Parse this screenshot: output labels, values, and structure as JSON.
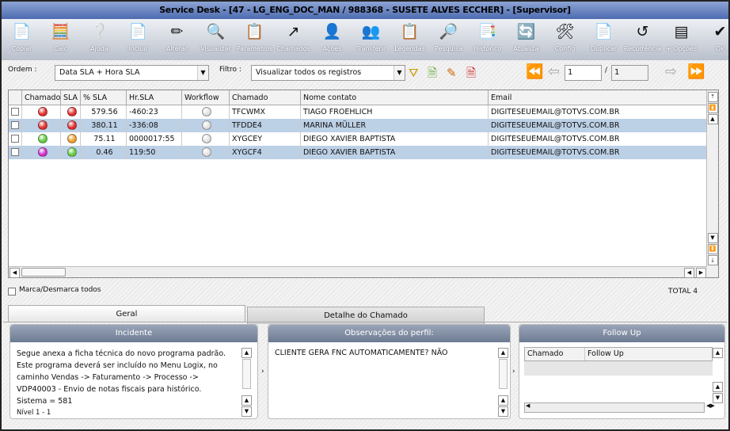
{
  "window": {
    "title": "Service Desk - [47 - LG_ENG_DOC_MAN / 988368 - SUSETE ALVES ECCHER] - [Supervisor]"
  },
  "toolbar": [
    {
      "label": "Copiar",
      "icon": "copy-icon",
      "glyph": "📄"
    },
    {
      "label": "Calc",
      "icon": "calculator-icon",
      "glyph": "🧮"
    },
    {
      "label": "Ajuda",
      "icon": "help-icon",
      "glyph": "❔"
    },
    {
      "label": "Incluir",
      "icon": "add-document-icon",
      "glyph": "📄"
    },
    {
      "label": "Alterar",
      "icon": "edit-icon",
      "glyph": "✏"
    },
    {
      "label": "Visualizar",
      "icon": "view-icon",
      "glyph": "🔍"
    },
    {
      "label": "Parametros",
      "icon": "parameters-icon",
      "glyph": "📋"
    },
    {
      "label": "Chamados",
      "icon": "tickets-icon",
      "glyph": "↗"
    },
    {
      "label": "Ações",
      "icon": "actions-icon",
      "glyph": "👤"
    },
    {
      "label": "Transferir",
      "icon": "transfer-icon",
      "glyph": "👥"
    },
    {
      "label": "Legendas",
      "icon": "legend-icon",
      "glyph": "📋"
    },
    {
      "label": "Pesquisa",
      "icon": "search-icon",
      "glyph": "🔎"
    },
    {
      "label": "Histórico",
      "icon": "history-icon",
      "glyph": "📑"
    },
    {
      "label": "Atualiza",
      "icon": "refresh-icon",
      "glyph": "🔄"
    },
    {
      "label": "Config",
      "icon": "tools-icon",
      "glyph": "🛠"
    },
    {
      "label": "Duplicar",
      "icon": "duplicate-icon",
      "glyph": "📄"
    },
    {
      "label": "Recorrência",
      "icon": "recurrence-icon",
      "glyph": "↺"
    },
    {
      "label": "+ Opções",
      "icon": "more-options-icon",
      "glyph": "▤"
    },
    {
      "label": "Ok",
      "icon": "check-icon",
      "glyph": "✔"
    }
  ],
  "filters": {
    "ordem_label": "Ordem :",
    "ordem_value": "Data SLA + Hora SLA",
    "filtro_label": "Filtro :",
    "filtro_value": "Visualizar todos os registros"
  },
  "pagination": {
    "current": "1",
    "separator": "/",
    "total": "1"
  },
  "grid": {
    "columns": [
      "",
      "Chamado",
      "SLA",
      "% SLA",
      "Hr.SLA",
      "Workflow",
      "Chamado",
      "Nome contato",
      "Email"
    ],
    "rows": [
      {
        "status": "#e03030",
        "sla": "#e03030",
        "pct": "579.56",
        "hr": "-460:23",
        "ticket": "TFCWMX",
        "contact": "TIAGO FROEHLICH",
        "email": "DIGITESEUEMAIL@TOTVS.COM.BR"
      },
      {
        "status": "#e03030",
        "sla": "#e03030",
        "pct": "380.11",
        "hr": "-336:08",
        "ticket": "TFDDE4",
        "contact": "MARINA MÜLLER",
        "email": "DIGITESEUEMAIL@TOTVS.COM.BR"
      },
      {
        "status": "#66cc44",
        "sla": "#f0a030",
        "pct": "75.11",
        "hr": "0000017:55",
        "ticket": "XYGCEY",
        "contact": "DIEGO XAVIER BAPTISTA",
        "email": "DIGITESEUEMAIL@TOTVS.COM.BR"
      },
      {
        "status": "#d030d0",
        "sla": "#66cc44",
        "pct": "0.46",
        "hr": "119:50",
        "ticket": "XYGCF4",
        "contact": "DIEGO XAVIER BAPTISTA",
        "email": "DIGITESEUEMAIL@TOTVS.COM.BR"
      }
    ]
  },
  "footer": {
    "select_all": "Marca/Desmarca todos",
    "total": "TOTAL 4"
  },
  "tabs": [
    "Geral",
    "Detalhe do Chamado"
  ],
  "panels": {
    "incidente": {
      "title": "Incidente",
      "lines": [
        "Segue anexa a ficha técnica do novo programa padrão.",
        "Este programa deverá ser incluído no Menu Logix, no",
        " caminho Vendas -> Faturamento -> Processo ->",
        " VDP40003 - Envio de notas fiscais para histórico.",
        "Sistema = 581",
        "Nível 1 - 1"
      ]
    },
    "observacoes": {
      "title": "Observações do perfil:",
      "text": "CLIENTE GERA FNC AUTOMATICAMENTE? NÃO"
    },
    "followup": {
      "title": "Follow Up",
      "columns": [
        "Chamado",
        "Follow Up"
      ]
    }
  }
}
